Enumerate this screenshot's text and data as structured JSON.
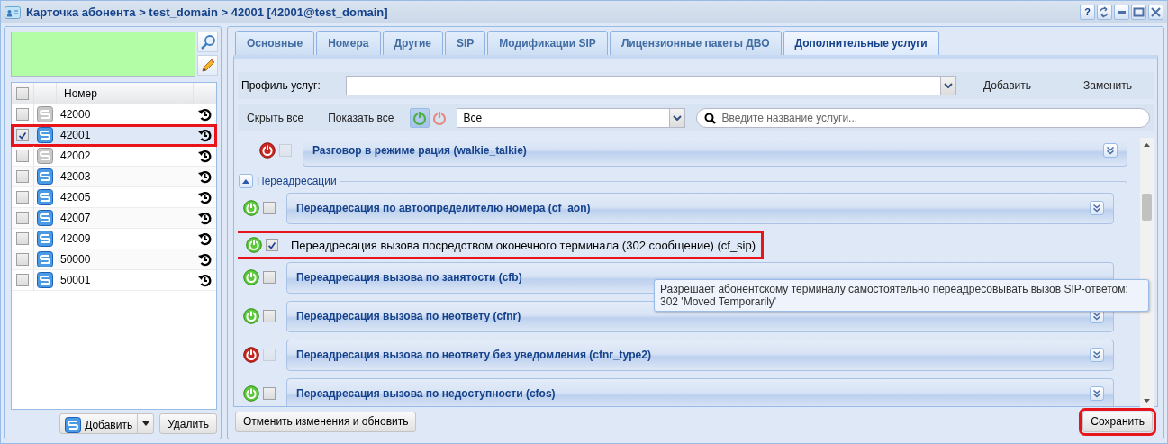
{
  "window": {
    "title": "Карточка абонента > test_domain > 42001 [42001@test_domain]",
    "help_button": "?"
  },
  "numbers": {
    "column": "Номер",
    "all_checked": false,
    "rows": [
      {
        "number": "42000",
        "checked": false,
        "active": false,
        "selected": false,
        "highlighted": false
      },
      {
        "number": "42001",
        "checked": true,
        "active": true,
        "selected": true,
        "highlighted": true
      },
      {
        "number": "42002",
        "checked": false,
        "active": false,
        "selected": false,
        "highlighted": false
      },
      {
        "number": "42003",
        "checked": false,
        "active": true,
        "selected": false,
        "highlighted": false
      },
      {
        "number": "42005",
        "checked": false,
        "active": true,
        "selected": false,
        "highlighted": false
      },
      {
        "number": "42007",
        "checked": false,
        "active": true,
        "selected": false,
        "highlighted": false
      },
      {
        "number": "42009",
        "checked": false,
        "active": true,
        "selected": false,
        "highlighted": false
      },
      {
        "number": "50000",
        "checked": false,
        "active": true,
        "selected": false,
        "highlighted": false
      },
      {
        "number": "50001",
        "checked": false,
        "active": true,
        "selected": false,
        "highlighted": false
      }
    ]
  },
  "sidebar_buttons": {
    "add": "Добавить",
    "delete": "Удалить"
  },
  "tabs": [
    {
      "label": "Основные",
      "selected": false
    },
    {
      "label": "Номера",
      "selected": false
    },
    {
      "label": "Другие",
      "selected": false
    },
    {
      "label": "SIP",
      "selected": false
    },
    {
      "label": "Модификации SIP",
      "selected": false
    },
    {
      "label": "Лицензионные пакеты ДВО",
      "selected": false
    },
    {
      "label": "Дополнительные услуги",
      "selected": true
    }
  ],
  "profile": {
    "label": "Профиль услуг:",
    "add": "Добавить",
    "replace": "Заменить"
  },
  "toolbar": {
    "hide_all": "Скрыть все",
    "show_all": "Показать все",
    "filter_on_pressed": true,
    "filter_off_pressed": false,
    "filter": "Все",
    "search_placeholder": "Введите название услуги..."
  },
  "services": [
    {
      "kind": "panel",
      "name": "Разговор в режиме рация (walkie_talkie)",
      "enabled": false,
      "checked": false,
      "disabled": true,
      "highlighted": false,
      "expander": true
    },
    {
      "kind": "group",
      "title": "Переадресации",
      "expanded": true,
      "children": [
        {
          "kind": "panel",
          "name": "Переадресация по автоопределителю номера (cf_aon)",
          "enabled": true,
          "checked": false,
          "disabled": false,
          "highlighted": false,
          "expander": true
        },
        {
          "kind": "plain",
          "name": "Переадресация вызова посредством оконечного терминала (302 сообщение) (cf_sip)",
          "enabled": true,
          "checked": true,
          "disabled": false,
          "highlighted": true
        },
        {
          "kind": "panel",
          "name": "Переадресация вызова по занятости (cfb)",
          "enabled": true,
          "checked": false,
          "disabled": false,
          "highlighted": false,
          "expander": false
        },
        {
          "kind": "panel",
          "name": "Переадресация вызова по неответу (cfnr)",
          "enabled": true,
          "checked": false,
          "disabled": false,
          "highlighted": false,
          "expander": true
        },
        {
          "kind": "panel",
          "name": "Переадресация вызова по неответу без уведомления (cfnr_type2)",
          "enabled": false,
          "checked": false,
          "disabled": true,
          "highlighted": false,
          "expander": true
        },
        {
          "kind": "panel",
          "name": "Переадресация вызова по недоступности (cfos)",
          "enabled": true,
          "checked": false,
          "disabled": false,
          "highlighted": false,
          "expander": true
        }
      ]
    }
  ],
  "tooltip": "Разрешает абонентскому терминалу самостоятельно переадресовывать вызов SIP-ответом:\n302 'Moved Temporarily'",
  "footer": {
    "reset": "Отменить изменения и обновить",
    "save": "Сохранить",
    "save_highlighted": true
  }
}
